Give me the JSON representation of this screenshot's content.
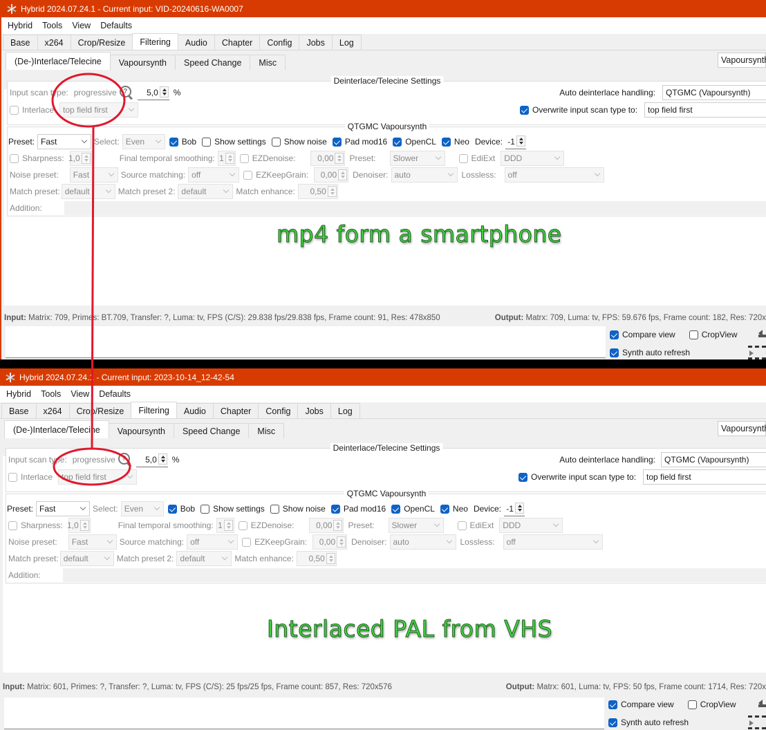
{
  "windows": [
    {
      "title": "Hybrid 2024.07.24.1 - Current input: VID-20240616-WA0007",
      "menu": [
        "Hybrid",
        "Tools",
        "View",
        "Defaults"
      ],
      "tabs": [
        "Base",
        "x264",
        "Crop/Resize",
        "Filtering",
        "Audio",
        "Chapter",
        "Config",
        "Jobs",
        "Log"
      ],
      "active_tab": "Filtering",
      "subtabs": [
        "(De-)Interlace/Telecine",
        "Vapoursynth",
        "Speed Change",
        "Misc"
      ],
      "active_subtab": "(De-)Interlace/Telecine",
      "right_combo": "Vapoursynth",
      "deint": {
        "title": "Deinterlace/Telecine Settings",
        "input_scan_label": "Input scan type:",
        "input_scan_value": "progressive",
        "threshold": "5,0",
        "threshold_unit": "%",
        "interlace_label": "Interlace",
        "interlace_checked": false,
        "field_order": "top field first",
        "auto_label": "Auto deinterlace handling:",
        "auto_value": "QTGMC (Vapoursynth)",
        "overwrite_label": "Overwrite input scan type to:",
        "overwrite_checked": true,
        "overwrite_value": "top field first"
      },
      "qtgmc": {
        "title": "QTGMC Vapoursynth",
        "preset_label": "Preset:",
        "preset": "Fast",
        "select_label": "Select:",
        "select": "Even",
        "bob_label": "Bob",
        "bob": true,
        "show_settings_label": "Show settings",
        "show_settings": false,
        "show_noise_label": "Show noise",
        "show_noise": false,
        "pad_label": "Pad mod16",
        "pad": true,
        "opencl_label": "OpenCL",
        "opencl": true,
        "neo_label": "Neo",
        "neo": true,
        "device_label": "Device:",
        "device": "-1",
        "sharpness_label": "Sharpness:",
        "sharpness": "1,0",
        "sharpness_checked": false,
        "fts_label": "Final temporal smoothing:",
        "fts": "1",
        "ezdenoise_label": "EZDenoise:",
        "ezdenoise": "0,00",
        "ezdenoise_checked": false,
        "preset2_label": "Preset:",
        "preset2": "Slower",
        "ediext_label": "EdiExt",
        "ediext_checked": false,
        "ediext": "DDD",
        "noise_preset_label": "Noise preset:",
        "noise_preset": "Fast",
        "source_matching_label": "Source matching:",
        "source_matching": "off",
        "ezkeep_label": "EZKeepGrain:",
        "ezkeep": "0,00",
        "ezkeep_checked": false,
        "denoiser_label": "Denoiser:",
        "denoiser": "auto",
        "lossless_label": "Lossless:",
        "lossless": "off",
        "match_preset_label": "Match preset:",
        "match_preset": "default",
        "match_preset2_label": "Match preset 2:",
        "match_preset2": "default",
        "match_enhance_label": "Match enhance:",
        "match_enhance": "0,50",
        "addition_label": "Addition:",
        "addition": ""
      },
      "overlay_note": "mp4 form a smartphone",
      "status_input_label": "Input:",
      "status_input": "Matrix: 709, Primes: BT.709, Transfer: ?, Luma: tv, FPS (C/S): 29.838 fps/29.838 fps, Frame count: 91, Res: 478x850",
      "status_output_label": "Output:",
      "status_output": "Matrx: 709, Luma: tv, FPS: 59.676 fps, Frame count: 182, Res: 720x",
      "compare_view_label": "Compare view",
      "compare_view": true,
      "cropview_label": "CropView",
      "cropview": false,
      "synth_refresh_label": "Synth auto refresh",
      "synth_refresh": true
    },
    {
      "title": "Hybrid 2024.07.24.1 - Current input: 2023-10-14_12-42-54",
      "menu": [
        "Hybrid",
        "Tools",
        "View",
        "Defaults"
      ],
      "tabs": [
        "Base",
        "x264",
        "Crop/Resize",
        "Filtering",
        "Audio",
        "Chapter",
        "Config",
        "Jobs",
        "Log"
      ],
      "active_tab": "Filtering",
      "subtabs": [
        "(De-)Interlace/Telecine",
        "Vapoursynth",
        "Speed Change",
        "Misc"
      ],
      "active_subtab": "(De-)Interlace/Telecine",
      "right_combo": "Vapoursynth",
      "deint": {
        "title": "Deinterlace/Telecine Settings",
        "input_scan_label": "Input scan type:",
        "input_scan_value": "progressive",
        "threshold": "5,0",
        "threshold_unit": "%",
        "interlace_label": "Interlace",
        "interlace_checked": false,
        "field_order": "top field first",
        "auto_label": "Auto deinterlace handling:",
        "auto_value": "QTGMC (Vapoursynth)",
        "overwrite_label": "Overwrite input scan type to:",
        "overwrite_checked": true,
        "overwrite_value": "top field first"
      },
      "qtgmc": {
        "title": "QTGMC Vapoursynth",
        "preset_label": "Preset:",
        "preset": "Fast",
        "select_label": "Select:",
        "select": "Even",
        "bob_label": "Bob",
        "bob": true,
        "show_settings_label": "Show settings",
        "show_settings": false,
        "show_noise_label": "Show noise",
        "show_noise": false,
        "pad_label": "Pad mod16",
        "pad": true,
        "opencl_label": "OpenCL",
        "opencl": true,
        "neo_label": "Neo",
        "neo": true,
        "device_label": "Device:",
        "device": "-1",
        "sharpness_label": "Sharpness:",
        "sharpness": "1,0",
        "sharpness_checked": false,
        "fts_label": "Final temporal smoothing:",
        "fts": "1",
        "ezdenoise_label": "EZDenoise:",
        "ezdenoise": "0,00",
        "ezdenoise_checked": false,
        "preset2_label": "Preset:",
        "preset2": "Slower",
        "ediext_label": "EdiExt",
        "ediext_checked": false,
        "ediext": "DDD",
        "noise_preset_label": "Noise preset:",
        "noise_preset": "Fast",
        "source_matching_label": "Source matching:",
        "source_matching": "off",
        "ezkeep_label": "EZKeepGrain:",
        "ezkeep": "0,00",
        "ezkeep_checked": false,
        "denoiser_label": "Denoiser:",
        "denoiser": "auto",
        "lossless_label": "Lossless:",
        "lossless": "off",
        "match_preset_label": "Match preset:",
        "match_preset": "default",
        "match_preset2_label": "Match preset 2:",
        "match_preset2": "default",
        "match_enhance_label": "Match enhance:",
        "match_enhance": "0,50",
        "addition_label": "Addition:",
        "addition": ""
      },
      "overlay_note": "Interlaced PAL from VHS",
      "status_input_label": "Input:",
      "status_input": "Matrix: 601, Primes: ?, Transfer: ?, Luma: tv, FPS (C/S): 25 fps/25 fps, Frame count: 857, Res: 720x576",
      "status_output_label": "Output:",
      "status_output": "Matrx: 601, Luma: tv, FPS: 50 fps, Frame count: 1714, Res: 720x",
      "compare_view_label": "Compare view",
      "compare_view": true,
      "cropview_label": "CropView",
      "cropview": false,
      "synth_refresh_label": "Synth auto refresh",
      "synth_refresh": true
    }
  ],
  "annotation": {
    "shape": "red ellipses around both 'progressive' scan type readouts, connected by a red line",
    "color": "#e0182d"
  },
  "colors": {
    "titlebar": "#d83b01",
    "checkbox_checked": "#0f62c6",
    "overlay_text": "#44d844"
  }
}
